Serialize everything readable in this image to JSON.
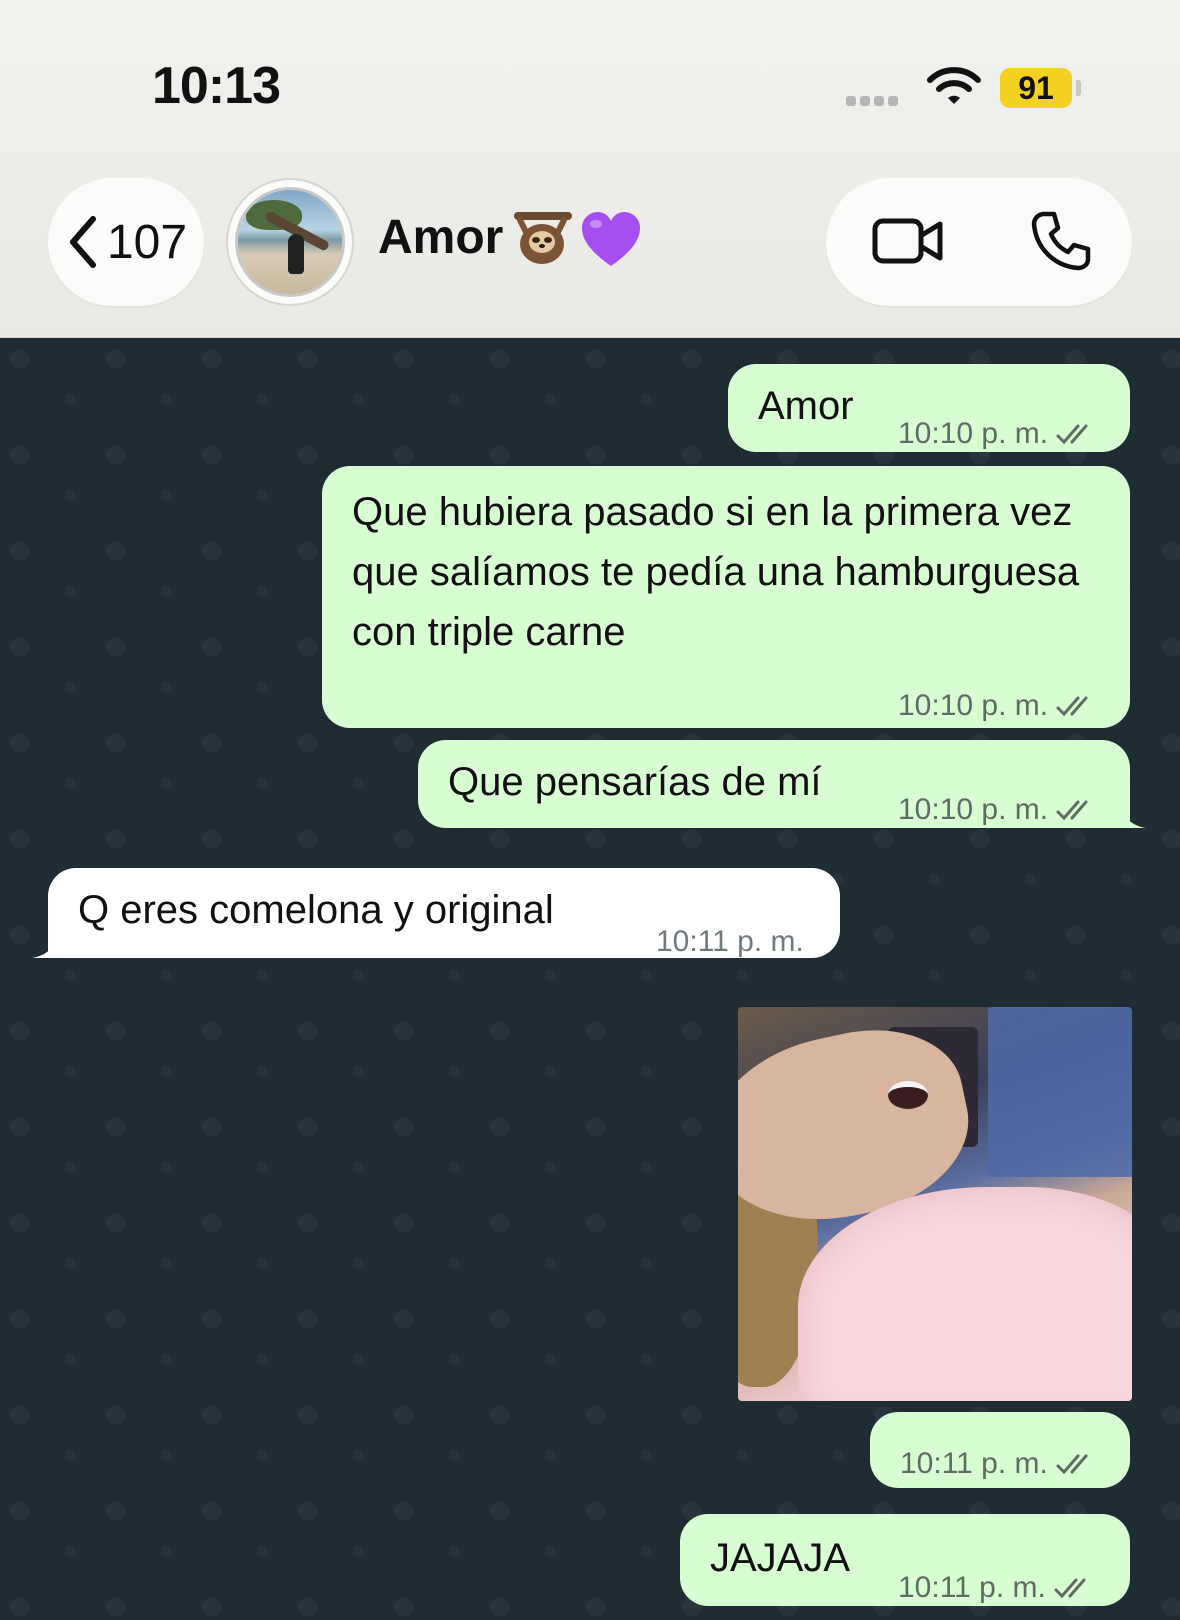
{
  "status_bar": {
    "time": "10:13",
    "battery": "91"
  },
  "header": {
    "back_count": "107",
    "contact_name": "Amor",
    "contact_emojis": [
      "sloth-emoji",
      "purple-heart-emoji"
    ]
  },
  "messages": [
    {
      "direction": "out",
      "text": "Amor",
      "time": "10:10 p. m.",
      "status": "read"
    },
    {
      "direction": "out",
      "text": "Que hubiera pasado si en la primera vez que salíamos te pedía una hamburguesa con triple carne",
      "time": "10:10 p. m.",
      "status": "read"
    },
    {
      "direction": "out",
      "text": "Que pensarías de mí",
      "time": "10:10 p. m.",
      "status": "read"
    },
    {
      "direction": "in",
      "text": "Q eres comelona y original",
      "time": "10:11 p. m."
    },
    {
      "direction": "out",
      "type": "image",
      "time": "10:11 p. m.",
      "status": "read"
    },
    {
      "direction": "out",
      "text": "JAJAJA",
      "time": "10:11 p. m.",
      "status": "read"
    }
  ],
  "colors": {
    "chat_background": "#1f2c34",
    "outgoing_bubble": "#d9fdd3",
    "incoming_bubble": "#ffffff",
    "read_ticks": "#5f6b63",
    "battery": "#f2d121"
  }
}
